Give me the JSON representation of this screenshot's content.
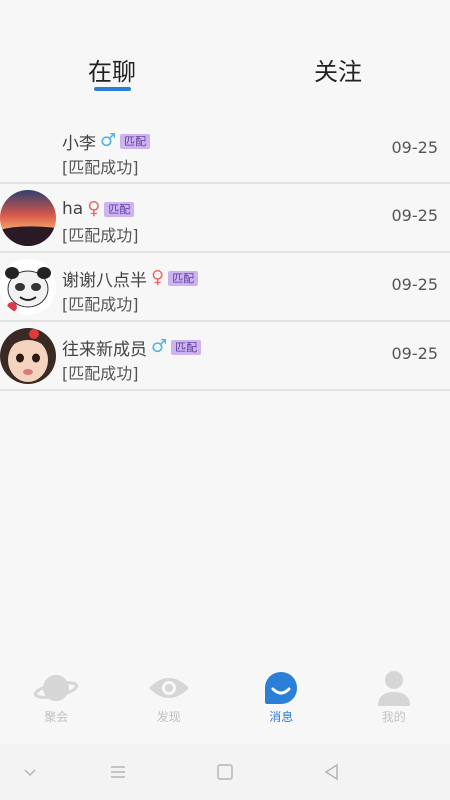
{
  "tabs": [
    {
      "label": "在聊",
      "active": true
    },
    {
      "label": "关注",
      "active": false
    }
  ],
  "conversations": [
    {
      "name": "小李",
      "gender": "male",
      "gender_symbol": "♂",
      "badge": "匹配",
      "preview": "[匹配成功]",
      "date": "09-25",
      "avatar": "none"
    },
    {
      "name": "ha",
      "gender": "female",
      "gender_symbol": "♀",
      "badge": "匹配",
      "preview": "[匹配成功]",
      "date": "09-25",
      "avatar": "sunset-photo"
    },
    {
      "name": "谢谢八点半",
      "gender": "female",
      "gender_symbol": "♀",
      "badge": "匹配",
      "preview": "[匹配成功]",
      "date": "09-25",
      "avatar": "panda-meme"
    },
    {
      "name": "往来新成员",
      "gender": "male",
      "gender_symbol": "♂",
      "badge": "匹配",
      "preview": "[匹配成功]",
      "date": "09-25",
      "avatar": "child-photo"
    }
  ],
  "bottom_nav": [
    {
      "label": "聚会",
      "icon": "planet-icon",
      "active": false
    },
    {
      "label": "发现",
      "icon": "eye-icon",
      "active": false
    },
    {
      "label": "消息",
      "icon": "message-bubble-icon",
      "active": true
    },
    {
      "label": "我的",
      "icon": "person-icon",
      "active": false
    }
  ],
  "colors": {
    "accent": "#2b7fd6",
    "male": "#4fb3e0",
    "female": "#ec6a6a",
    "badge_bg": "#cdb3f0"
  }
}
